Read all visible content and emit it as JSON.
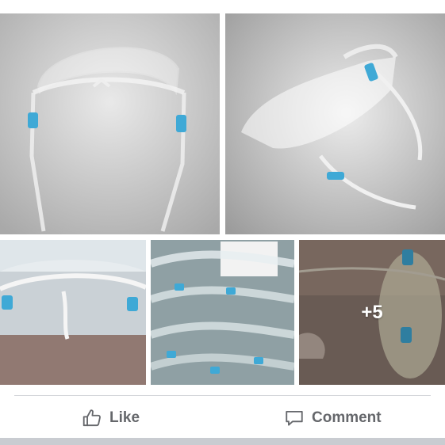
{
  "post": {
    "photos": [
      {
        "subject": "face-shield-front-view"
      },
      {
        "subject": "face-shield-side-view"
      },
      {
        "subject": "face-shield-worn-closeup"
      },
      {
        "subject": "face-shields-packed-bundle"
      },
      {
        "subject": "face-shield-packaged"
      }
    ],
    "more_photos_label": "+5"
  },
  "actions": {
    "like_label": "Like",
    "comment_label": "Comment"
  },
  "colors": {
    "action_text": "#65676b",
    "divider": "#d4d6da",
    "hinge_blue": "#3fa9d6"
  }
}
